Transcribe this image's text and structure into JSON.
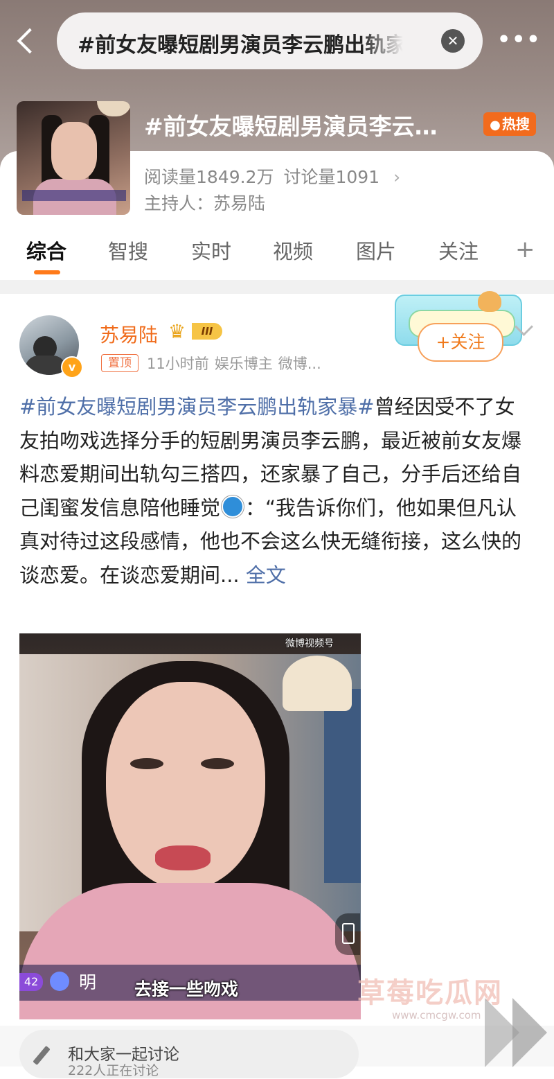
{
  "search": {
    "query": "#前女友曝短剧男演员李云鹏出轨家"
  },
  "topic": {
    "title": "#前女友曝短剧男演员李云…",
    "hot_badge": "热搜",
    "reads": "阅读量1849.2万",
    "discussions": "讨论量1091",
    "host": "主持人：苏易陆"
  },
  "tabs": [
    {
      "label": "综合",
      "active": true
    },
    {
      "label": "智搜"
    },
    {
      "label": "实时"
    },
    {
      "label": "视频"
    },
    {
      "label": "图片"
    },
    {
      "label": "关注"
    }
  ],
  "post": {
    "author": "苏易陆",
    "level_badge": "III",
    "pinned": "置顶",
    "time": "11小时前",
    "role": "娱乐博主",
    "source": "微博...",
    "follow": "+关注",
    "hashtag": "#前女友曝短剧男演员李云鹏出轨家暴#",
    "text_part1": "曾经因受不了女友拍吻戏选择分手的短剧男演员李云鹏，最近被前女友爆料恋爱期间出轨勾三搭四，还家暴了自己，分手后还给自己闺蜜发信息陪他睡觉",
    "text_part2": "：“我告诉你们，他如果但凡认真对待过这段感情，他也不会这么快无缝衔接，这么快的谈恋爱。在谈恋爱期间...",
    "full_text_link": "全文"
  },
  "video": {
    "watermark": "微博视频号",
    "live_level": "42",
    "live_name": "明",
    "subtitle": "去接一些吻戏"
  },
  "watermark_site": {
    "name": "草莓吃瓜网",
    "url": "www.cmcgw.com"
  },
  "discuss": {
    "title": "和大家一起讨论",
    "subtitle": "222人正在讨论"
  },
  "colors": {
    "accent": "#f06b1a",
    "link": "#4f6fa8",
    "hot": "#f26b1d"
  }
}
